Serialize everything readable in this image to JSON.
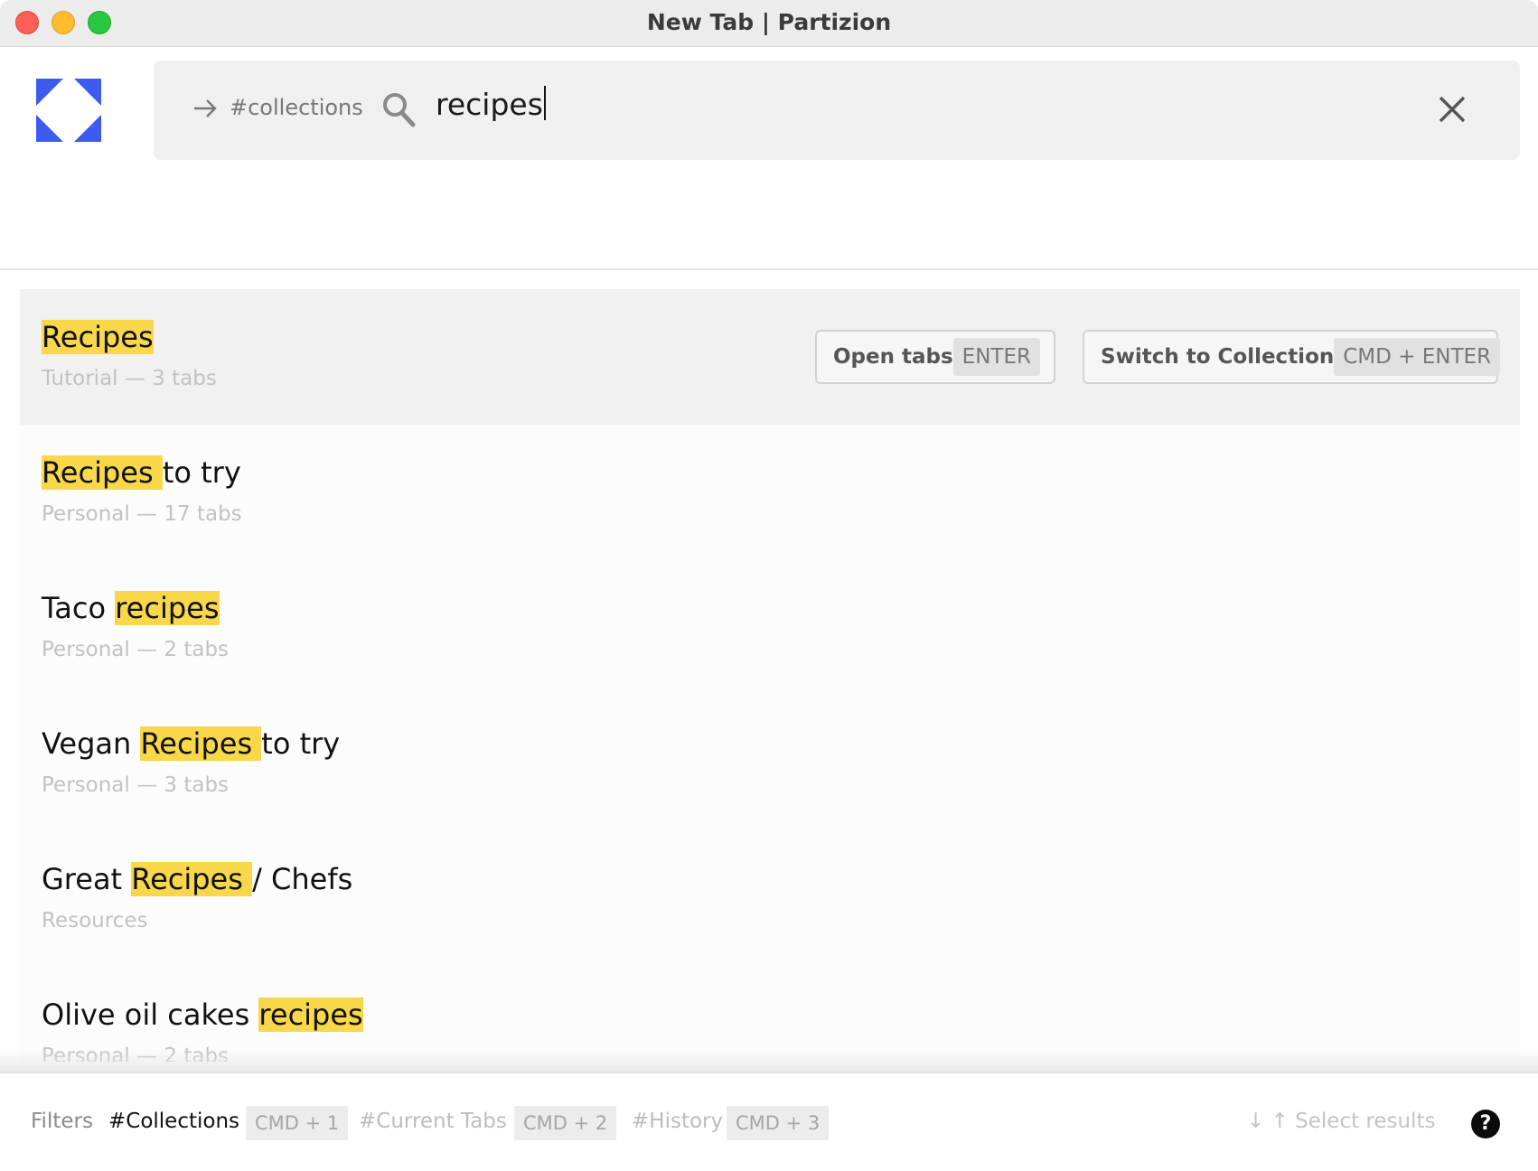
{
  "window": {
    "title": "New Tab | Partizion"
  },
  "search": {
    "scope": "#collections",
    "query": "recipes",
    "icons": {
      "scope_arrow": "arrow-right-icon",
      "search": "search-icon",
      "clear": "close-icon"
    }
  },
  "brand": {
    "logo": "partizion-logo",
    "color": "#3d5af1"
  },
  "highlight_color": "#f8d74a",
  "results": [
    {
      "title": {
        "before": "",
        "match": "Recipes",
        "after": ""
      },
      "subtitle": "Tutorial — 3 tabs",
      "selected": true
    },
    {
      "title": {
        "before": "",
        "match": "Recipes ",
        "after": "to try"
      },
      "subtitle": "Personal — 17 tabs"
    },
    {
      "title": {
        "before": "Taco ",
        "match": "recipes",
        "after": ""
      },
      "subtitle": "Personal — 2 tabs"
    },
    {
      "title": {
        "before": "Vegan ",
        "match": "Recipes ",
        "after": "to try"
      },
      "subtitle": "Personal — 3 tabs"
    },
    {
      "title": {
        "before": "Great ",
        "match": "Recipes ",
        "after": "/ Chefs"
      },
      "subtitle": "Resources"
    },
    {
      "title": {
        "before": "Olive oil cakes ",
        "match": "recipes",
        "after": ""
      },
      "subtitle": "Personal — 2 tabs"
    }
  ],
  "actions": {
    "open": {
      "label": "Open tabs",
      "shortcut": "ENTER"
    },
    "switch": {
      "label": "Switch to Collection",
      "shortcut": "CMD + ENTER"
    }
  },
  "footer": {
    "filters_label": "Filters",
    "filters": [
      {
        "label": "#Collections",
        "shortcut": "CMD + 1",
        "active": true
      },
      {
        "label": "#Current Tabs",
        "shortcut": "CMD + 2",
        "active": false
      },
      {
        "label": "#History",
        "shortcut": "CMD + 3",
        "active": false
      }
    ],
    "navigation_hint": "↓ ↑  Select results",
    "help": "?"
  }
}
